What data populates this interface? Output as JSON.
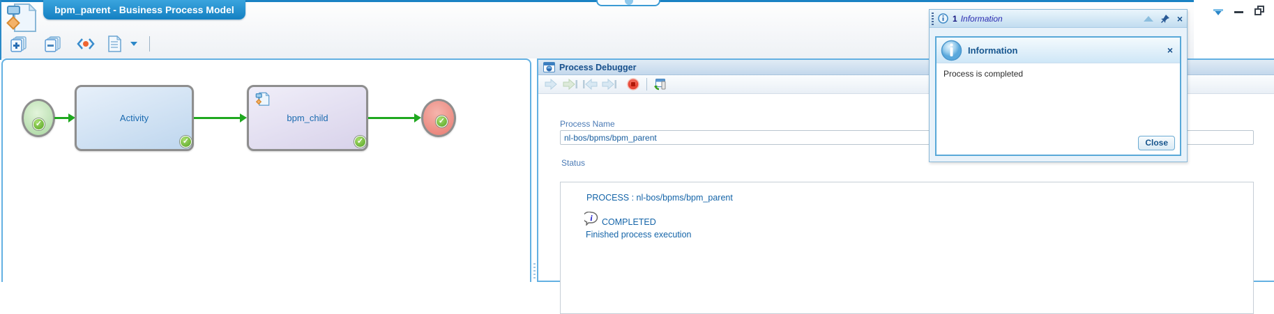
{
  "colors": {
    "tab_blue": "#1e8ec8",
    "panel_border_blue": "#63b0e2",
    "flow_green": "#1fa81f",
    "status_text_blue": "#1464a8",
    "stop_red": "#d83828"
  },
  "window": {
    "controls": {
      "menu": "caret-down",
      "minimize": "minimize",
      "restore": "restore"
    }
  },
  "model_tab": {
    "title": "bpm_parent - Business Process Model"
  },
  "main_toolbar": {
    "icons": [
      "pages-plus",
      "pages-minus",
      "angle-dot-validate",
      "document-report",
      "dropdown-caret"
    ]
  },
  "diagram": {
    "nodes": [
      {
        "type": "start-event",
        "label": ""
      },
      {
        "type": "activity",
        "label": "Activity"
      },
      {
        "type": "subprocess",
        "label": "bpm_child"
      },
      {
        "type": "end-event",
        "label": ""
      }
    ],
    "status_badge": "completed-check"
  },
  "debugger_panel": {
    "title": "Process Debugger",
    "toolbar_icons": [
      "run-arrow",
      "step-over-arrow",
      "step-into-arrow",
      "step-return-arrow",
      "stop",
      "refresh-view"
    ],
    "process_name_label": "Process Name",
    "process_name_value": "nl-bos/bpms/bpm_parent",
    "status_label": "Status",
    "status": {
      "process_line": "PROCESS : nl-bos/bpms/bpm_parent",
      "state": "COMPLETED",
      "detail": "Finished process execution"
    }
  },
  "notification": {
    "count": "1",
    "title": "Information",
    "dialog": {
      "title": "Information",
      "message": "Process is completed",
      "close_label": "Close"
    }
  }
}
